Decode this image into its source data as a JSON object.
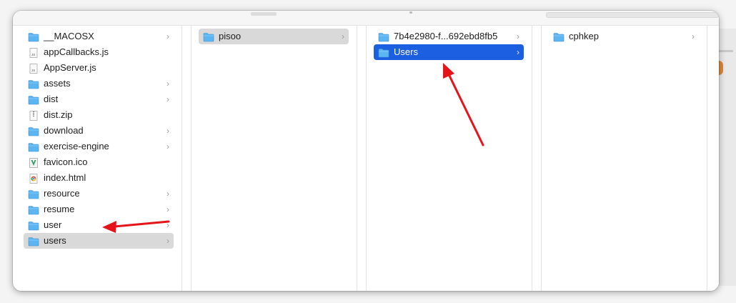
{
  "columns": [
    {
      "items": [
        {
          "label": "__MACOSX",
          "icon": "folder-icon",
          "chevron": "›"
        },
        {
          "label": "appCallbacks.js",
          "icon": "js-file-icon",
          "chevron": ""
        },
        {
          "label": "AppServer.js",
          "icon": "js-file-icon",
          "chevron": ""
        },
        {
          "label": "assets",
          "icon": "folder-icon",
          "chevron": "›"
        },
        {
          "label": "dist",
          "icon": "folder-icon",
          "chevron": "›"
        },
        {
          "label": "dist.zip",
          "icon": "zip-file-icon",
          "chevron": ""
        },
        {
          "label": "download",
          "icon": "folder-icon",
          "chevron": "›"
        },
        {
          "label": "exercise-engine",
          "icon": "folder-icon",
          "chevron": "›"
        },
        {
          "label": "favicon.ico",
          "icon": "ico-file-icon",
          "chevron": ""
        },
        {
          "label": "index.html",
          "icon": "html-file-icon",
          "chevron": ""
        },
        {
          "label": "resource",
          "icon": "folder-icon",
          "chevron": "›"
        },
        {
          "label": "resume",
          "icon": "folder-icon",
          "chevron": "›"
        },
        {
          "label": "user",
          "icon": "folder-icon",
          "chevron": "›"
        },
        {
          "label": "users",
          "icon": "folder-icon",
          "chevron": "›",
          "selected": "inactive"
        }
      ]
    },
    {
      "items": [
        {
          "label": "pisoo",
          "icon": "folder-icon",
          "chevron": "›",
          "selected": "inactive"
        }
      ]
    },
    {
      "items": [
        {
          "label": "7b4e2980-f...692ebd8fb5",
          "icon": "folder-icon",
          "chevron": "›"
        },
        {
          "label": "Users",
          "icon": "folder-icon",
          "chevron": "›",
          "selected": "active"
        }
      ]
    },
    {
      "items": [
        {
          "label": "cphkep",
          "icon": "folder-icon",
          "chevron": "›"
        }
      ]
    }
  ],
  "colors": {
    "selection_active": "#1c5fe0",
    "selection_inactive": "#d9d9d9",
    "folder": "#5cb4f0",
    "annotation_arrow": "#e5141b"
  }
}
